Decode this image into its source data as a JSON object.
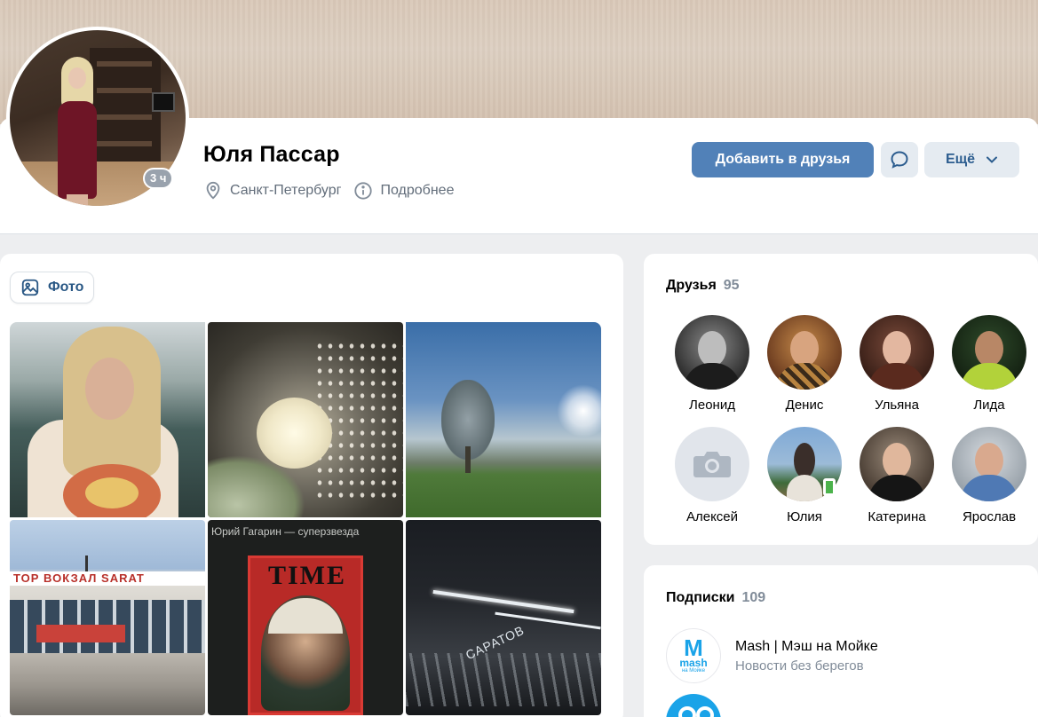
{
  "profile": {
    "name": "Юля Пассар",
    "last_seen": "3 ч",
    "city": "Санкт-Петербург",
    "details_link": "Подробнее"
  },
  "actions": {
    "add_friend": "Добавить в друзья",
    "message_icon": "message-bubble-icon",
    "more": "Ещё"
  },
  "photos": {
    "tab_label": "Фото",
    "items": [
      {
        "subject": "girl-eating-pasta"
      },
      {
        "subject": "white-flower-bouquet"
      },
      {
        "subject": "park-tree-blue-sky"
      },
      {
        "subject": "railway-station-building",
        "text": "ТОР ВОКЗАЛ SARAT"
      },
      {
        "subject": "time-magazine-gagarin",
        "headline": "Юрий Гагарин — суперзвезда",
        "cover_title": "TIME"
      },
      {
        "subject": "night-station-platform",
        "text": "САРАТОВ"
      }
    ]
  },
  "friends": {
    "title": "Друзья",
    "count": "95",
    "items": [
      {
        "name": "Леонид",
        "online": false
      },
      {
        "name": "Денис",
        "online": false
      },
      {
        "name": "Ульяна",
        "online": false
      },
      {
        "name": "Лида",
        "online": false
      },
      {
        "name": "Алексей",
        "online": false,
        "placeholder": true
      },
      {
        "name": "Юлия",
        "online": true
      },
      {
        "name": "Катерина",
        "online": false
      },
      {
        "name": "Ярослав",
        "online": false
      }
    ]
  },
  "subscriptions": {
    "title": "Подписки",
    "count": "109",
    "items": [
      {
        "name": "Mash | Мэш на Мойке",
        "description": "Новости без берегов",
        "logo_text": "M",
        "logo_word": "mash",
        "logo_sub": "на Мойке"
      }
    ]
  },
  "colors": {
    "primary_button": "#5181b8",
    "secondary_button": "#e5ebf1",
    "link": "#2a5885",
    "muted": "#818c99",
    "online": "#4bb34b",
    "page_bg": "#edeef0"
  }
}
